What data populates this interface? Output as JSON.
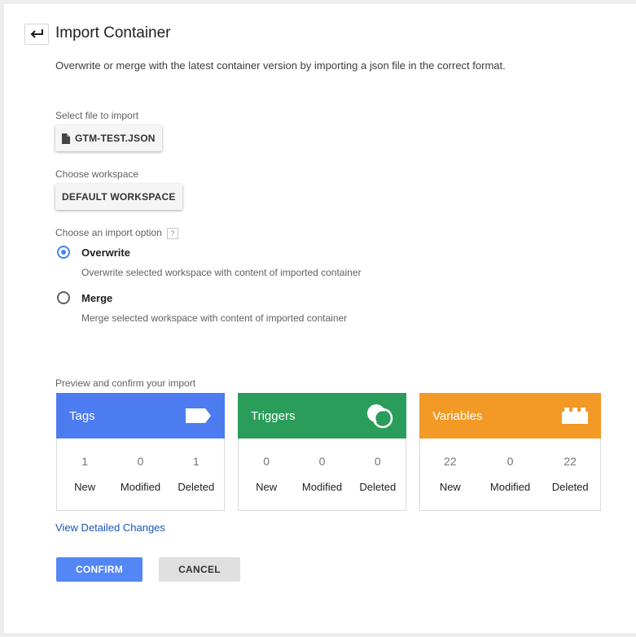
{
  "header": {
    "title": "Import Container"
  },
  "description": "Overwrite or merge with the latest container version by importing a json file in the correct format.",
  "file": {
    "label": "Select file to import",
    "button": "GTM-TEST.JSON"
  },
  "workspace": {
    "label": "Choose workspace",
    "button": "DEFAULT WORKSPACE"
  },
  "import_option": {
    "label": "Choose an import option",
    "help": "?",
    "options": [
      {
        "label": "Overwrite",
        "desc": "Overwrite selected workspace with content of imported container",
        "selected": true
      },
      {
        "label": "Merge",
        "desc": "Merge selected workspace with content of imported container",
        "selected": false
      }
    ]
  },
  "preview": {
    "label": "Preview and confirm your import",
    "cards": [
      {
        "title": "Tags",
        "color": "#4d7cf0",
        "icon": "tag-icon",
        "stats": [
          {
            "value": "1",
            "label": "New"
          },
          {
            "value": "0",
            "label": "Modified"
          },
          {
            "value": "1",
            "label": "Deleted"
          }
        ]
      },
      {
        "title": "Triggers",
        "color": "#2a9d5a",
        "icon": "trigger-icon",
        "stats": [
          {
            "value": "0",
            "label": "New"
          },
          {
            "value": "0",
            "label": "Modified"
          },
          {
            "value": "0",
            "label": "Deleted"
          }
        ]
      },
      {
        "title": "Variables",
        "color": "#f39926",
        "icon": "variable-icon",
        "stats": [
          {
            "value": "22",
            "label": "New"
          },
          {
            "value": "0",
            "label": "Modified"
          },
          {
            "value": "22",
            "label": "Deleted"
          }
        ]
      }
    ]
  },
  "link": "View Detailed Changes",
  "actions": {
    "confirm": "CONFIRM",
    "cancel": "CANCEL"
  },
  "colors": {
    "primary": "#5486f5",
    "cancel_bg": "#e0e0e0"
  }
}
